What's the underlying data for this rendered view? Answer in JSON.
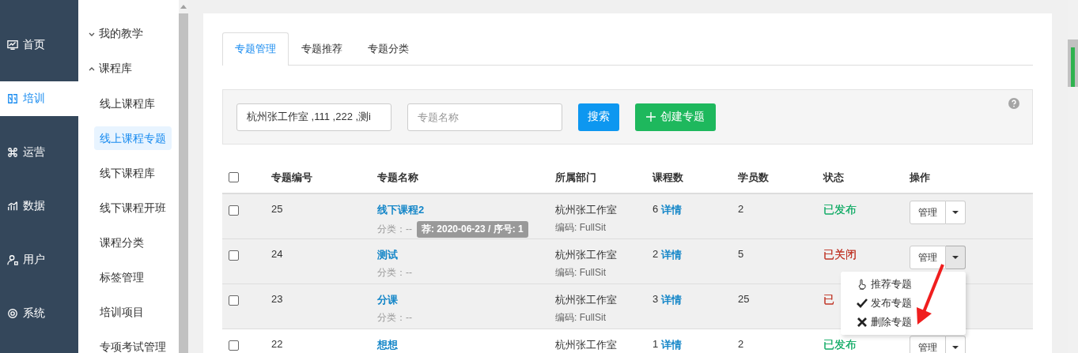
{
  "nav": [
    {
      "label": "首页",
      "selected": false
    },
    {
      "label": "培训",
      "selected": true
    },
    {
      "label": "运营",
      "selected": false
    },
    {
      "label": "数据",
      "selected": false
    },
    {
      "label": "用户",
      "selected": false
    },
    {
      "label": "系统",
      "selected": false
    }
  ],
  "submenu": [
    {
      "label": "我的教学",
      "expanded": false
    },
    {
      "label": "课程库",
      "expanded": true,
      "children": [
        {
          "label": "线上课程库",
          "selected": false
        },
        {
          "label": "线上课程专题",
          "selected": true
        },
        {
          "label": "线下课程库",
          "selected": false
        },
        {
          "label": "线下课程开班",
          "selected": false
        },
        {
          "label": "课程分类",
          "selected": false
        },
        {
          "label": "标签管理",
          "selected": false
        },
        {
          "label": "培训项目",
          "selected": false
        },
        {
          "label": "专项考试管理",
          "selected": false
        }
      ]
    }
  ],
  "tabs": [
    {
      "label": "专题管理",
      "selected": true
    },
    {
      "label": "专题推荐",
      "selected": false
    },
    {
      "label": "专题分类",
      "selected": false
    }
  ],
  "filters": {
    "department": {
      "value": "杭州张工作室 ,111 ,222 ,测i"
    },
    "name": {
      "placeholder": "专题名称"
    },
    "search_button": "搜索",
    "create_button": "创建专题"
  },
  "table": {
    "all_checked": false,
    "columns": [
      "专题编号",
      "专题名称",
      "所属部门",
      "课程数",
      "学员数",
      "状态",
      "操作"
    ],
    "rows": [
      {
        "checked": false,
        "highlighted": true,
        "id": "25",
        "name": "线下课程2",
        "category": "分类：--",
        "tag": "荐: 2020-06-23 / 序号: 1",
        "department": "杭州张工作室",
        "code": "编码: FullSit",
        "course_count": "6",
        "detail": "详情",
        "students": "2",
        "status": "已发布",
        "color": "#1aae6b",
        "manage": "管理"
      },
      {
        "checked": false,
        "highlighted": true,
        "id": "24",
        "name": "测试",
        "category": "分类：--",
        "department": "杭州张工作室",
        "code": "编码: FullSit",
        "course_count": "2",
        "detail": "详情",
        "students": "5",
        "status": "已关闭",
        "color": "#c0392b",
        "manage": "管理",
        "open": true
      },
      {
        "checked": false,
        "highlighted": true,
        "id": "23",
        "name": "分课",
        "category": "分类：--",
        "department": "杭州张工作室",
        "code": "编码: FullSit",
        "course_count": "3",
        "detail": "详情",
        "students": "25",
        "status": "已",
        "color": "#c0392b"
      },
      {
        "checked": false,
        "highlighted": false,
        "id": "22",
        "name": "想想",
        "department": "杭州张工作室",
        "course_count": "1",
        "detail": "详情",
        "students": "2",
        "status": "已发布",
        "color": "#1aae6b",
        "manage": "管理"
      }
    ]
  },
  "dropdown": [
    {
      "label": "推荐专题"
    },
    {
      "label": "发布专题"
    },
    {
      "label": "删除专题"
    }
  ]
}
